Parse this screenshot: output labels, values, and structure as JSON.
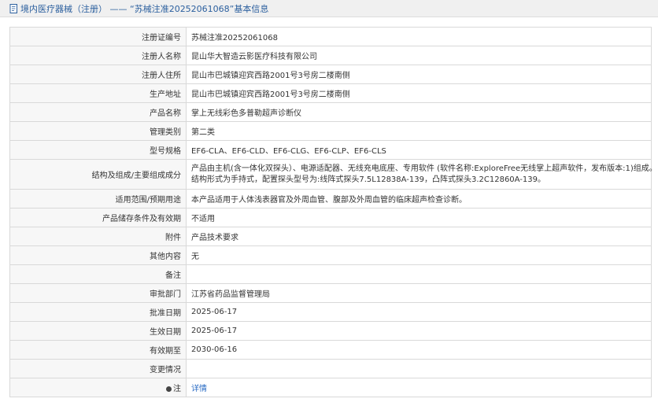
{
  "header": {
    "title": "境内医疗器械（注册） —— “苏械注准20252061068”基本信息"
  },
  "rows": [
    {
      "label": "注册证编号",
      "value": "苏械注准20252061068"
    },
    {
      "label": "注册人名称",
      "value": "昆山华大智造云影医疗科技有限公司"
    },
    {
      "label": "注册人住所",
      "value": "昆山市巴城镇迎宾西路2001号3号房二楼南侧"
    },
    {
      "label": "生产地址",
      "value": "昆山市巴城镇迎宾西路2001号3号房二楼南侧"
    },
    {
      "label": "产品名称",
      "value": "掌上无线彩色多普勒超声诊断仪"
    },
    {
      "label": "管理类别",
      "value": "第二类"
    },
    {
      "label": "型号规格",
      "value": "EF6-CLA、EF6-CLD、EF6-CLG、EF6-CLP、EF6-CLS"
    },
    {
      "label": "结构及组成/主要组成成分",
      "value_line1": "产品由主机(含一体化双探头）、电源适配器、无线充电底座、专用软件 (软件名称:ExploreFree无线掌上超声软件，发布版本:1)组成。",
      "value_line2": "结构形式为手持式，配置探头型号为:线阵式探头7.5L12838A-139，凸阵式探头3.2C12860A-139。"
    },
    {
      "label": "适用范围/预期用途",
      "value": "本产品适用于人体浅表器官及外周血管、腹部及外周血管的临床超声检查诊断。"
    },
    {
      "label": "产品储存条件及有效期",
      "value": "不适用"
    },
    {
      "label": "附件",
      "value": "产品技术要求"
    },
    {
      "label": "其他内容",
      "value": "无"
    },
    {
      "label": "备注",
      "value": ""
    },
    {
      "label": "审批部门",
      "value": "江苏省药品监督管理局"
    },
    {
      "label": "批准日期",
      "value": "2025-06-17"
    },
    {
      "label": "生效日期",
      "value": "2025-06-17"
    },
    {
      "label": "有效期至",
      "value": "2030-06-16"
    },
    {
      "label": "变更情况",
      "value": ""
    },
    {
      "label": "注",
      "value": "详情"
    }
  ]
}
